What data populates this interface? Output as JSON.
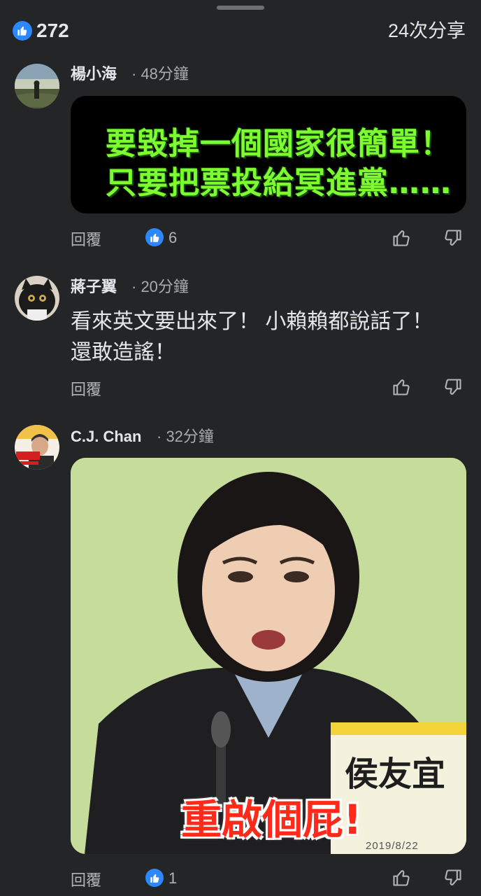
{
  "post_stats": {
    "like_count": "272",
    "share_text": "24次分享"
  },
  "comments": [
    {
      "name": "楊小海",
      "time": "· 48分鐘",
      "image_text": [
        "要毀掉一個國家很簡單！",
        "只要把票投給冥進黨……"
      ],
      "reply_label": "回覆",
      "reaction_count": "6"
    },
    {
      "name": "蔣子翼",
      "time": "· 20分鐘",
      "text": "看來英文要出來了！ 小賴賴都說話了！ 還敢造謠！",
      "reply_label": "回覆"
    },
    {
      "name": "C.J. Chan",
      "time": "· 32分鐘",
      "image_caption": "重啟個屁!",
      "image_nameplate": "侯友宜",
      "image_date": "2019/8/22",
      "reply_label": "回覆",
      "reaction_count": "1"
    }
  ],
  "icons": {
    "like": "thumbs-up-icon",
    "dislike": "thumbs-down-icon"
  },
  "colors": {
    "background": "#242526",
    "accent": "#2d88ff",
    "meme_green": "#7dfc2f",
    "caption_red": "#ff2a1a"
  }
}
